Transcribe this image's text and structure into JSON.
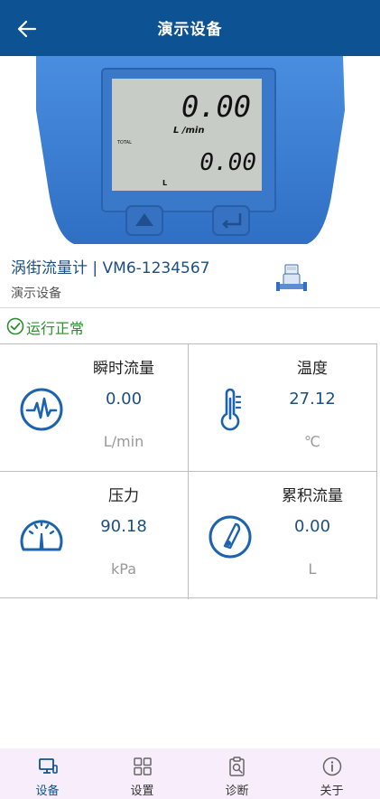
{
  "header": {
    "title": "演示设备"
  },
  "device": {
    "name": "涡街流量计 | VM6-1234567",
    "subtitle": "演示设备",
    "lcd": {
      "flow_value": "0.00",
      "flow_unit": "L  /min",
      "total_label": "TOTAL",
      "total_value": "0.00",
      "total_unit": "L"
    }
  },
  "status": {
    "text": "运行正常",
    "color": "#2e8b2e"
  },
  "metrics": [
    {
      "title": "瞬时流量",
      "value": "0.00",
      "unit": "L/min",
      "icon": "waveform-icon"
    },
    {
      "title": "温度",
      "value": "27.12",
      "unit": "℃",
      "icon": "thermometer-icon"
    },
    {
      "title": "压力",
      "value": "90.18",
      "unit": "kPa",
      "icon": "gauge-icon"
    },
    {
      "title": "累积流量",
      "value": "0.00",
      "unit": "L",
      "icon": "flow-meter-icon"
    }
  ],
  "tabs": [
    {
      "label": "设备",
      "icon": "device-icon",
      "active": true
    },
    {
      "label": "设置",
      "icon": "grid-icon",
      "active": false
    },
    {
      "label": "诊断",
      "icon": "clipboard-search-icon",
      "active": false
    },
    {
      "label": "关于",
      "icon": "info-icon",
      "active": false
    }
  ],
  "colors": {
    "header": "#0d5394",
    "accent": "#1c4f82",
    "device_blue": "#3b7fd2",
    "tabbar_bg": "#f8eefb"
  }
}
